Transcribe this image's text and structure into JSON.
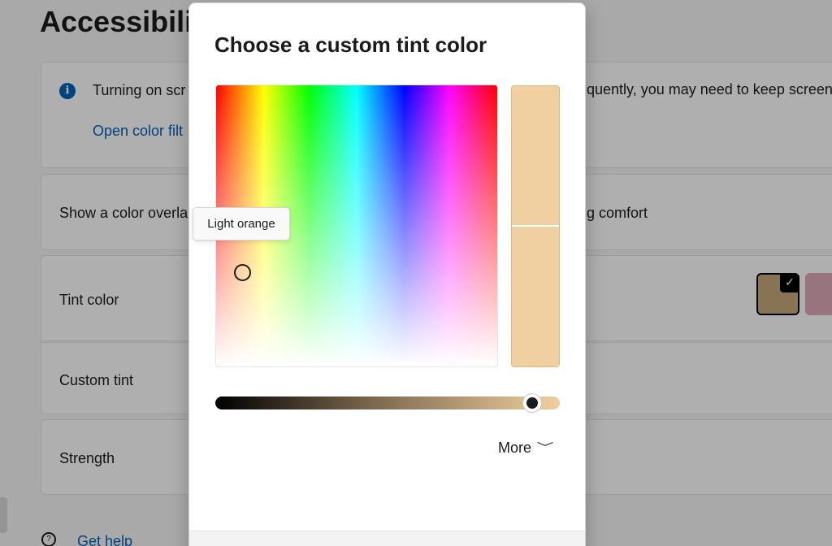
{
  "background_page": {
    "title": "Accessibilit",
    "info": {
      "icon": "info-icon",
      "text": "Turning on scr",
      "right_text": "quently, you may need to keep screen",
      "link": "Open color filt"
    },
    "overlay": {
      "label": "Show a color overla",
      "right_text": "g comfort"
    },
    "tint_color": {
      "label": "Tint color",
      "swatches": [
        {
          "color": "#c4a57a",
          "selected": true
        },
        {
          "color": "#d9a6b5",
          "selected": false
        }
      ]
    },
    "custom_tint": {
      "label": "Custom tint"
    },
    "strength": {
      "label": "Strength"
    },
    "help": {
      "label": "Get help",
      "icon": "help-icon"
    }
  },
  "dialog": {
    "title": "Choose a custom tint color",
    "tooltip": "Light orange",
    "selected_color": "#f0d0a0",
    "more_label": "More",
    "more_icon": "chevron-down-icon"
  }
}
